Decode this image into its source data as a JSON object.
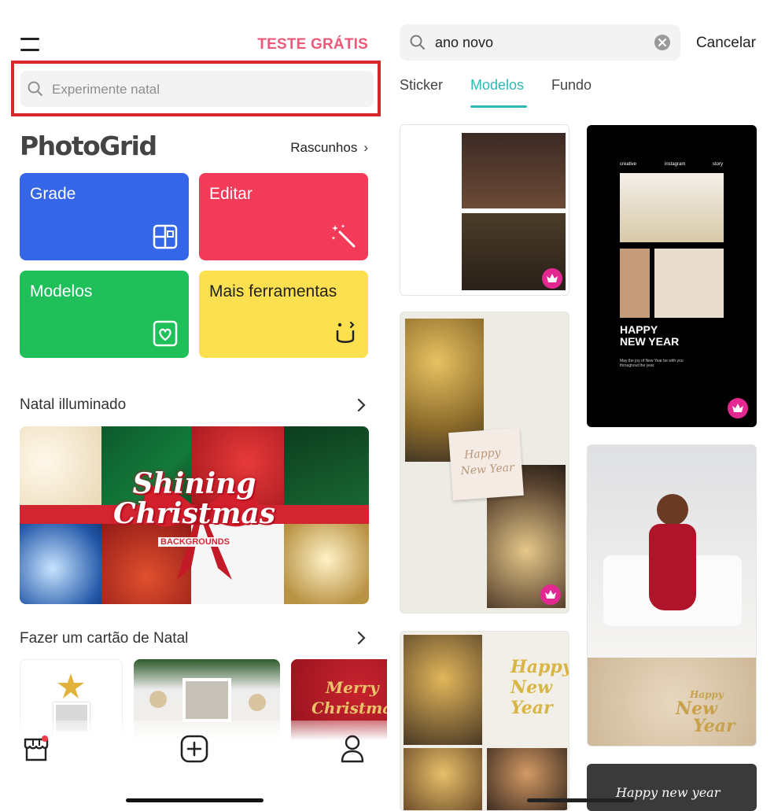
{
  "left": {
    "trial_label": "TESTE GRÁTIS",
    "search_placeholder": "Experimente natal",
    "logo": "PhotoGrid",
    "drafts_label": "Rascunhos",
    "tiles": [
      {
        "label": "Grade",
        "icon": "grid-icon",
        "color": "#3466e7"
      },
      {
        "label": "Editar",
        "icon": "magic-wand-icon",
        "color": "#f33a58"
      },
      {
        "label": "Modelos",
        "icon": "heart-frame-icon",
        "color": "#1fc05a"
      },
      {
        "label": "Mais ferramentas",
        "icon": "smiley-icon",
        "color": "#fde04f"
      }
    ],
    "section1_title": "Natal illuminado",
    "banner": {
      "line1": "Shining",
      "line2": "Christmas",
      "line3": "BACKGROUNDS"
    },
    "section2_title": "Fazer um cartão de Natal",
    "card3_text": {
      "line1": "Merry",
      "line2": "Christmas"
    },
    "bottom_nav": [
      "store-icon",
      "add-icon",
      "profile-icon"
    ]
  },
  "right": {
    "search_value": "ano novo",
    "cancel_label": "Cancelar",
    "tabs": [
      {
        "label": "Sticker",
        "active": false
      },
      {
        "label": "Modelos",
        "active": true
      },
      {
        "label": "Fundo",
        "active": false
      }
    ],
    "templates": {
      "t2_header": [
        "creative",
        "instagram",
        "story"
      ],
      "t2_title_1": "HAPPY",
      "t2_title_2": "NEW YEAR",
      "t2_sub": "May the joy of New Year be with you throughout the year.",
      "t3_note_1": "Happy",
      "t3_note_2": "New Year",
      "t4_text_1": "Happy",
      "t4_text_2": "New",
      "t4_text_3": "Year",
      "t5_text_1": "Happy",
      "t5_text_2": "New",
      "t5_text_3": "Year",
      "t6_text": "Happy new year"
    },
    "accent_color": "#2fb9b5",
    "premium_color": "#e32892"
  }
}
